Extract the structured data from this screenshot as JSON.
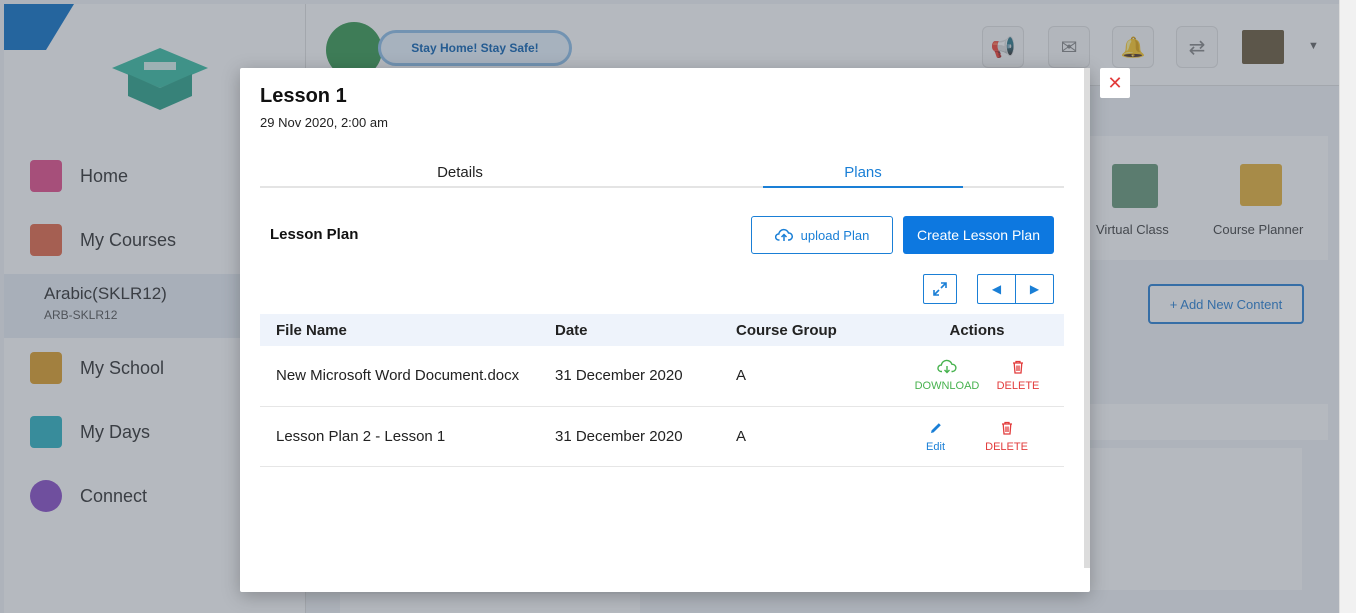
{
  "background": {
    "sidebar": {
      "items": [
        {
          "label": "Home",
          "color": "#e64f8c"
        },
        {
          "label": "My Courses",
          "color": "#e56a4a"
        },
        {
          "label": "My School",
          "color": "#e0a02a"
        },
        {
          "label": "My Days",
          "color": "#30b5c4"
        },
        {
          "label": "Connect",
          "color": "#8a4fc8"
        }
      ],
      "active_course": {
        "name": "Arabic(SKLR12)",
        "code": "ARB-SKLR12"
      }
    },
    "header": {
      "banner": "Stay Home! Stay Safe!"
    },
    "tiles": [
      {
        "label": "Virtual Class"
      },
      {
        "label": "Course Planner"
      }
    ],
    "add_content_label": "+ Add New Content"
  },
  "modal": {
    "title": "Lesson 1",
    "datetime": "29 Nov 2020, 2:00 am",
    "tabs": [
      {
        "label": "Details",
        "active": false
      },
      {
        "label": "Plans",
        "active": true
      }
    ],
    "section_label": "Lesson Plan",
    "upload_label": "upload Plan",
    "create_label": "Create Lesson Plan",
    "table": {
      "headers": [
        "File Name",
        "Date",
        "Course Group",
        "Actions"
      ],
      "rows": [
        {
          "file_name": "New Microsoft Word Document.docx",
          "date": "31 December 2020",
          "group": "A",
          "primary_action": "DOWNLOAD",
          "secondary_action": "DELETE"
        },
        {
          "file_name": "Lesson Plan 2 - Lesson 1",
          "date": "31 December 2020",
          "group": "A",
          "primary_action": "Edit",
          "secondary_action": "DELETE"
        }
      ]
    }
  },
  "colors": {
    "primary": "#0d78e0",
    "download": "#47b24e",
    "delete": "#e23b3b"
  }
}
